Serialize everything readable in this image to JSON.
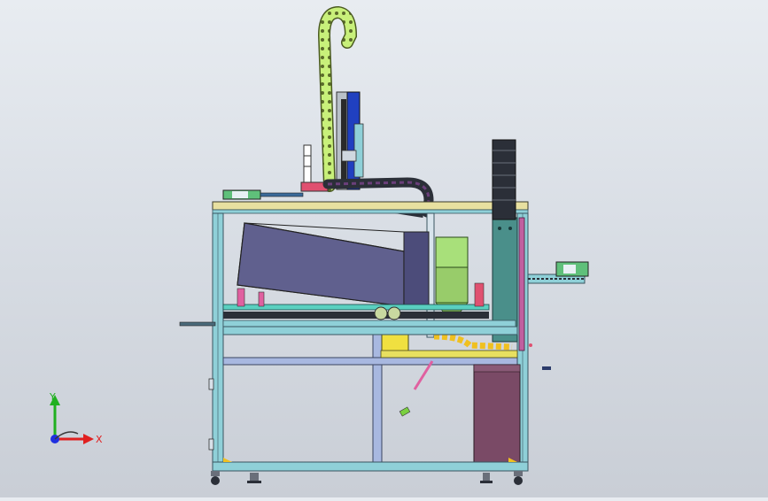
{
  "viewport": {
    "background_top": "#e8ecf1",
    "background_bottom": "#c9ced6"
  },
  "triad": {
    "x_label": "X",
    "y_label": "Y",
    "x_color": "#e02020",
    "y_color": "#20b020",
    "z_color": "#2030e0"
  },
  "colors": {
    "frame": "#8fd0d8",
    "frame_edge": "#3a5560",
    "hopper": "#5a5a8a",
    "chain": "#c8f07a",
    "teal_column": "#4a8f8a",
    "bin": "#7a4a66",
    "cable_chain_dark": "#2b2f38",
    "green_block": "#a8e07a",
    "yellow_block": "#f0e040",
    "blue_axis": "#2040c0"
  }
}
